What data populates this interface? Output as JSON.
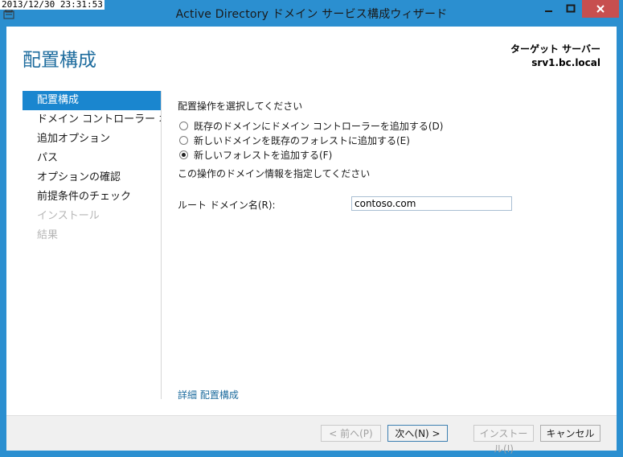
{
  "overlay": {
    "timestamp": "2013/12/30 23:31:53"
  },
  "window": {
    "title": "Active Directory ドメイン サービス構成ウィザード"
  },
  "header": {
    "page_title": "配置構成",
    "target_label": "ターゲット サーバー",
    "target_server": "srv1.bc.local"
  },
  "nav": {
    "items": [
      {
        "label": "配置構成",
        "state": "active"
      },
      {
        "label": "ドメイン コントローラー オプ…",
        "state": "normal"
      },
      {
        "label": "追加オプション",
        "state": "normal"
      },
      {
        "label": "パス",
        "state": "normal"
      },
      {
        "label": "オプションの確認",
        "state": "normal"
      },
      {
        "label": "前提条件のチェック",
        "state": "normal"
      },
      {
        "label": "インストール",
        "state": "disabled"
      },
      {
        "label": "結果",
        "state": "disabled"
      }
    ]
  },
  "content": {
    "operation_heading": "配置操作を選択してください",
    "options": [
      {
        "label": "既存のドメインにドメイン コントローラーを追加する(D)",
        "checked": false
      },
      {
        "label": "新しいドメインを既存のフォレストに追加する(E)",
        "checked": false
      },
      {
        "label": "新しいフォレストを追加する(F)",
        "checked": true
      }
    ],
    "domain_heading": "この操作のドメイン情報を指定してください",
    "root_domain_label": "ルート ドメイン名(R):",
    "root_domain_value": "contoso.com",
    "more_link": "詳細 配置構成"
  },
  "footer": {
    "prev": "< 前へ(P)",
    "next": "次へ(N) >",
    "install": "インストール(I)",
    "cancel": "キャンセル"
  },
  "colors": {
    "titlebar": "#2b8fd0",
    "accent": "#1a86cf",
    "title_text": "#1e6c9e",
    "close_button": "#c74f4f"
  }
}
